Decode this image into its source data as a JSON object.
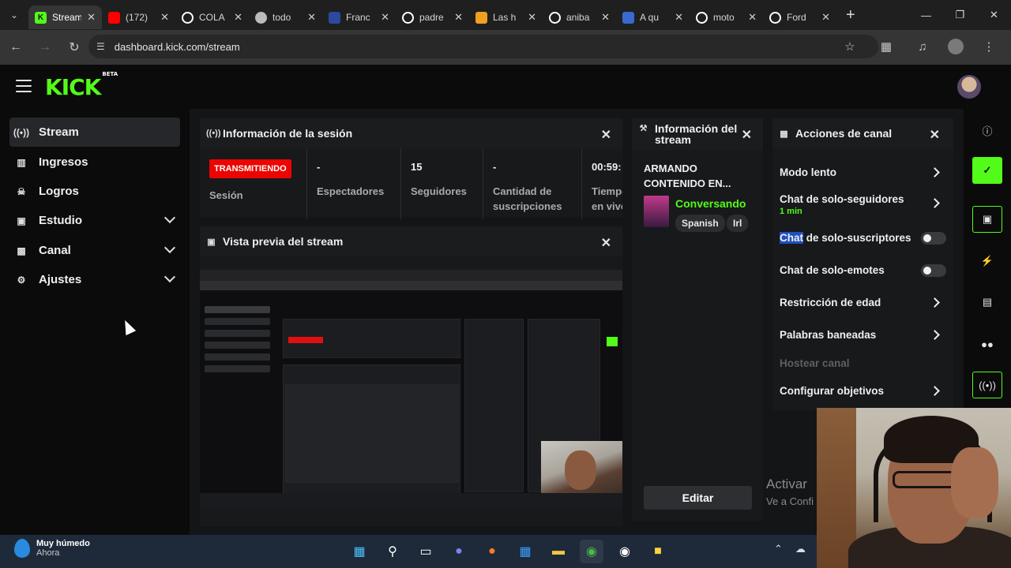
{
  "browser": {
    "tabs": [
      {
        "title": "Stream",
        "fav": "kick",
        "color": "#53fc18",
        "active": true
      },
      {
        "title": "(172)",
        "fav": "youtube",
        "color": "#ff0000"
      },
      {
        "title": "COLA",
        "fav": "google",
        "color": "#ffffff"
      },
      {
        "title": "todo",
        "fav": "web",
        "color": "#bbbbbb"
      },
      {
        "title": "Franc",
        "fav": "flag",
        "color": "#2a4aa0"
      },
      {
        "title": "padre",
        "fav": "google",
        "color": "#ffffff"
      },
      {
        "title": "Las h",
        "fav": "info",
        "color": "#f0a020"
      },
      {
        "title": "aniba",
        "fav": "google",
        "color": "#ffffff"
      },
      {
        "title": "A qu",
        "fav": "dictionary",
        "color": "#3a6ad0"
      },
      {
        "title": "moto",
        "fav": "google",
        "color": "#ffffff"
      },
      {
        "title": "Ford",
        "fav": "google",
        "color": "#ffffff"
      }
    ],
    "url": "dashboard.kick.com/stream"
  },
  "kick": {
    "logo": "KICK",
    "logo_badge": "BETA"
  },
  "sidebar": {
    "items": [
      {
        "label": "Stream",
        "icon": "broadcast-icon"
      },
      {
        "label": "Ingresos",
        "icon": "bar-chart-icon"
      },
      {
        "label": "Logros",
        "icon": "trophy-icon"
      },
      {
        "label": "Estudio",
        "icon": "studio-icon"
      },
      {
        "label": "Canal",
        "icon": "channel-icon"
      },
      {
        "label": "Ajustes",
        "icon": "gear-icon"
      }
    ]
  },
  "session": {
    "title": "Información de la sesión",
    "status_badge": "TRANSMITIENDO",
    "session_label": "Sesión",
    "viewers_value": "-",
    "viewers_label": "Espectadores",
    "followers_value": "15",
    "followers_label": "Seguidores",
    "subs_value": "-",
    "subs_label": "Cantidad de suscripciones",
    "time_value": "00:59:",
    "time_label": "Tiempo en vivo"
  },
  "preview": {
    "title": "Vista previa del stream"
  },
  "stream_info": {
    "title": "Información del stream",
    "stream_title": "ARMANDO CONTENIDO EN...",
    "category": "Conversando",
    "tags": [
      "Spanish",
      "Irl"
    ],
    "edit_label": "Editar"
  },
  "channel_actions": {
    "title": "Acciones de canal",
    "slow_mode": "Modo lento",
    "followers_only": "Chat de solo-seguidores",
    "followers_only_sub": "1 min",
    "subs_only_hl": "Chat",
    "subs_only_rest": " de solo-suscriptores",
    "emotes_only": "Chat de solo-emotes",
    "age_restriction": "Restricción de edad",
    "banned_words": "Palabras baneadas",
    "host_channel": "Hostear canal",
    "goals": "Configurar objetivos"
  },
  "watermark": {
    "line1": "Activar",
    "line2": "Ve a Confi"
  },
  "taskbar": {
    "weather_title": "Muy húmedo",
    "weather_sub": "Ahora"
  }
}
